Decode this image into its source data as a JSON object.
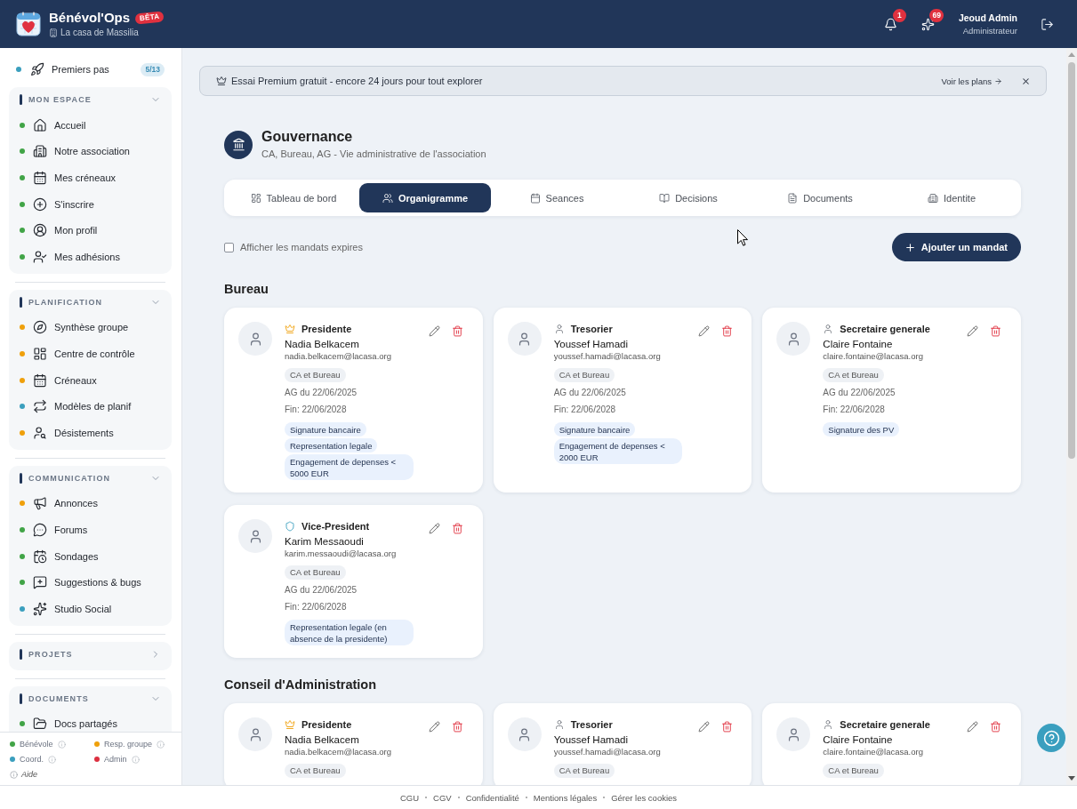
{
  "header": {
    "app_name": "Bénévol'Ops",
    "badge": "BÊTA",
    "organization": "La casa de Massilia",
    "notifications": "1",
    "suggestions": "69",
    "user_name": "Jeoud Admin",
    "user_role": "Administrateur"
  },
  "sidebar": {
    "getting_started": {
      "label": "Premiers pas",
      "progress": "5/13",
      "color": "#3b9fbe"
    },
    "sections": [
      {
        "title": "MON ESPACE",
        "expanded": true,
        "items": [
          {
            "label": "Accueil",
            "color": "#41a447"
          },
          {
            "label": "Notre association",
            "color": "#41a447"
          },
          {
            "label": "Mes créneaux",
            "color": "#41a447"
          },
          {
            "label": "S'inscrire",
            "color": "#41a447"
          },
          {
            "label": "Mon profil",
            "color": "#41a447"
          },
          {
            "label": "Mes adhésions",
            "color": "#41a447"
          }
        ]
      },
      {
        "title": "PLANIFICATION",
        "expanded": true,
        "items": [
          {
            "label": "Synthèse groupe",
            "color": "#efa00b"
          },
          {
            "label": "Centre de contrôle",
            "color": "#efa00b"
          },
          {
            "label": "Créneaux",
            "color": "#efa00b"
          },
          {
            "label": "Modèles de planif",
            "color": "#3b9fbe"
          },
          {
            "label": "Désistements",
            "color": "#efa00b"
          }
        ]
      },
      {
        "title": "COMMUNICATION",
        "expanded": true,
        "items": [
          {
            "label": "Annonces",
            "color": "#efa00b"
          },
          {
            "label": "Forums",
            "color": "#41a447"
          },
          {
            "label": "Sondages",
            "color": "#41a447"
          },
          {
            "label": "Suggestions & bugs",
            "color": "#41a447"
          },
          {
            "label": "Studio Social",
            "color": "#3b9fbe"
          }
        ]
      },
      {
        "title": "PROJETS",
        "expanded": false
      },
      {
        "title": "DOCUMENTS",
        "expanded": true,
        "items": [
          {
            "label": "Docs partagés",
            "color": "#41a447"
          }
        ]
      }
    ],
    "legend": [
      {
        "label": "Bénévole",
        "color": "#41a447"
      },
      {
        "label": "Resp. groupe",
        "color": "#efa00b"
      },
      {
        "label": "Coord.",
        "color": "#3b9fbe"
      },
      {
        "label": "Admin",
        "color": "#dc3040"
      }
    ],
    "help_label": "Aide"
  },
  "banner": {
    "text": "Essai Premium gratuit - encore 24 jours pour tout explorer",
    "link": "Voir les plans"
  },
  "page": {
    "title": "Gouvernance",
    "subtitle": "CA, Bureau, AG - Vie administrative de l'association"
  },
  "tabs": [
    {
      "label": "Tableau de bord",
      "selected": false
    },
    {
      "label": "Organigramme",
      "selected": true
    },
    {
      "label": "Seances",
      "selected": false
    },
    {
      "label": "Decisions",
      "selected": false
    },
    {
      "label": "Documents",
      "selected": false
    },
    {
      "label": "Identite",
      "selected": false
    }
  ],
  "toolbar": {
    "show_expired": {
      "label": "Afficher les mandats expires",
      "checked": false
    },
    "add_button": "Ajouter un mandat"
  },
  "groups": [
    {
      "title": "Bureau",
      "mandates": [
        {
          "kind": "crown",
          "role": "Presidente",
          "name": "Nadia Belkacem",
          "email": "nadia.belkacem@lacasa.org",
          "body": "CA et Bureau",
          "elected": "AG du 22/06/2025",
          "end": "Fin: 22/06/2028",
          "powers": [
            "Signature bancaire",
            "Representation legale",
            "Engagement de depenses < 5000 EUR"
          ]
        },
        {
          "kind": "person",
          "role": "Tresorier",
          "name": "Youssef Hamadi",
          "email": "youssef.hamadi@lacasa.org",
          "body": "CA et Bureau",
          "elected": "AG du 22/06/2025",
          "end": "Fin: 22/06/2028",
          "powers": [
            "Signature bancaire",
            "Engagement de depenses < 2000 EUR"
          ]
        },
        {
          "kind": "person",
          "role": "Secretaire generale",
          "name": "Claire Fontaine",
          "email": "claire.fontaine@lacasa.org",
          "body": "CA et Bureau",
          "elected": "AG du 22/06/2025",
          "end": "Fin: 22/06/2028",
          "powers": [
            "Signature des PV"
          ]
        },
        {
          "kind": "shield",
          "role": "Vice-President",
          "name": "Karim Messaoudi",
          "email": "karim.messaoudi@lacasa.org",
          "body": "CA et Bureau",
          "elected": "AG du 22/06/2025",
          "end": "Fin: 22/06/2028",
          "powers": [
            "Representation legale (en absence de la presidente)"
          ]
        }
      ]
    },
    {
      "title": "Conseil d'Administration",
      "mandates": [
        {
          "kind": "crown",
          "role": "Presidente",
          "name": "Nadia Belkacem",
          "email": "nadia.belkacem@lacasa.org",
          "body": "CA et Bureau"
        },
        {
          "kind": "person",
          "role": "Tresorier",
          "name": "Youssef Hamadi",
          "email": "youssef.hamadi@lacasa.org",
          "body": "CA et Bureau"
        },
        {
          "kind": "person",
          "role": "Secretaire generale",
          "name": "Claire Fontaine",
          "email": "claire.fontaine@lacasa.org",
          "body": "CA et Bureau"
        }
      ]
    }
  ],
  "footer": {
    "links": [
      "CGU",
      "CGV",
      "Confidentialité",
      "Mentions légales",
      "Gérer les cookies"
    ]
  }
}
